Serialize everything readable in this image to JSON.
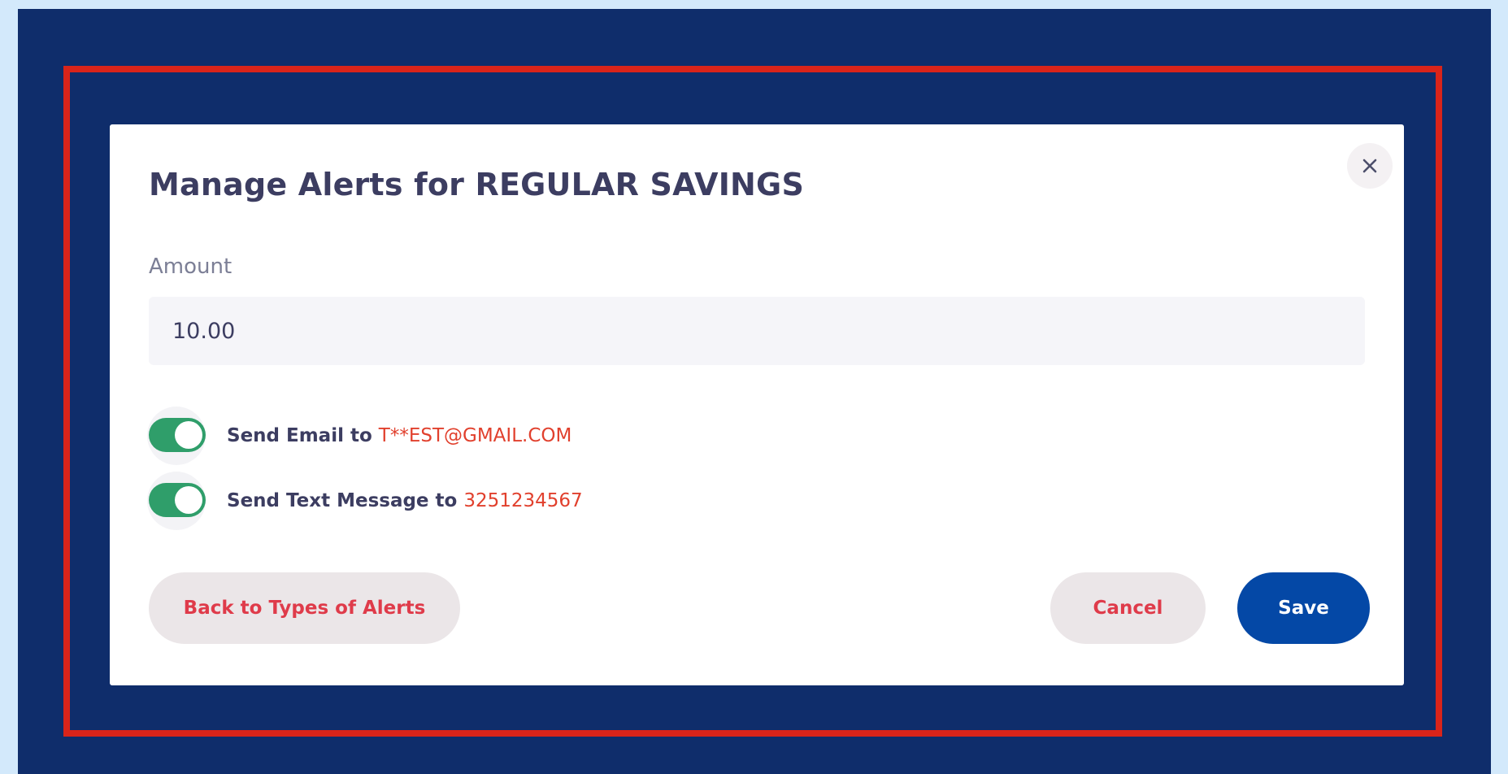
{
  "modal": {
    "title": "Manage Alerts for REGULAR SAVINGS",
    "close_icon": "close-icon"
  },
  "amount": {
    "label": "Amount",
    "value": "10.00"
  },
  "email_alert": {
    "label": "Send Email to",
    "target": "T**EST@GMAIL.COM",
    "enabled": true
  },
  "sms_alert": {
    "label": "Send Text Message to",
    "target": "3251234567",
    "enabled": true
  },
  "buttons": {
    "back": "Back to Types of Alerts",
    "cancel": "Cancel",
    "save": "Save"
  },
  "colors": {
    "backdrop": "#0f2d6b",
    "highlight": "#d9241a",
    "toggle_on": "#2f9e6a",
    "accent_red": "#df3b4a",
    "primary_blue": "#0448a6"
  }
}
